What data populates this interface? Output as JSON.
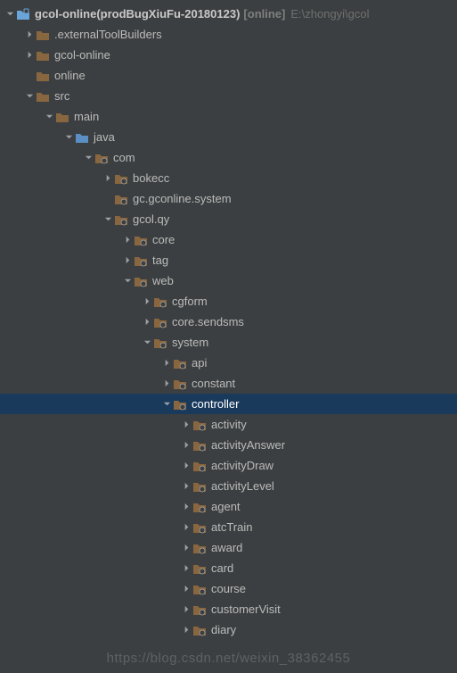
{
  "icons": {
    "module_fill": "#6aa4d8",
    "folder_fill": "#88663f",
    "pkg_fill": "#88663f",
    "src_fill": "#5b8ec4"
  },
  "watermark": "https://blog.csdn.net/weixin_38362455",
  "rows": [
    {
      "indent": 0,
      "arrow": "down",
      "icon": "module",
      "selected": false,
      "label": {
        "bold": "gcol-online(prodBugXiuFu-20180123)",
        "dec": "[online]",
        "path": "E:\\zhongyi\\gcol"
      }
    },
    {
      "indent": 1,
      "arrow": "right",
      "icon": "folder",
      "selected": false,
      "label": {
        "text": ".externalToolBuilders"
      }
    },
    {
      "indent": 1,
      "arrow": "right",
      "icon": "folder",
      "selected": false,
      "label": {
        "text": "gcol-online"
      }
    },
    {
      "indent": 1,
      "arrow": "blank",
      "icon": "folder",
      "selected": false,
      "label": {
        "text": "online"
      }
    },
    {
      "indent": 1,
      "arrow": "down",
      "icon": "folder",
      "selected": false,
      "label": {
        "text": "src"
      }
    },
    {
      "indent": 2,
      "arrow": "down",
      "icon": "folder",
      "selected": false,
      "label": {
        "text": "main"
      }
    },
    {
      "indent": 3,
      "arrow": "down",
      "icon": "src",
      "selected": false,
      "label": {
        "text": "java"
      }
    },
    {
      "indent": 4,
      "arrow": "down",
      "icon": "pkg",
      "selected": false,
      "label": {
        "text": "com"
      }
    },
    {
      "indent": 5,
      "arrow": "right",
      "icon": "pkg",
      "selected": false,
      "label": {
        "text": "bokecc"
      }
    },
    {
      "indent": 5,
      "arrow": "blank",
      "icon": "pkg",
      "selected": false,
      "label": {
        "text": "gc.gconline.system"
      }
    },
    {
      "indent": 5,
      "arrow": "down",
      "icon": "pkg",
      "selected": false,
      "label": {
        "text": "gcol.qy"
      }
    },
    {
      "indent": 6,
      "arrow": "right",
      "icon": "pkg",
      "selected": false,
      "label": {
        "text": "core"
      }
    },
    {
      "indent": 6,
      "arrow": "right",
      "icon": "pkg",
      "selected": false,
      "label": {
        "text": "tag"
      }
    },
    {
      "indent": 6,
      "arrow": "down",
      "icon": "pkg",
      "selected": false,
      "label": {
        "text": "web"
      }
    },
    {
      "indent": 7,
      "arrow": "right",
      "icon": "pkg",
      "selected": false,
      "label": {
        "text": "cgform"
      }
    },
    {
      "indent": 7,
      "arrow": "right",
      "icon": "pkg",
      "selected": false,
      "label": {
        "text": "core.sendsms"
      }
    },
    {
      "indent": 7,
      "arrow": "down",
      "icon": "pkg",
      "selected": false,
      "label": {
        "text": "system"
      }
    },
    {
      "indent": 8,
      "arrow": "right",
      "icon": "pkg",
      "selected": false,
      "label": {
        "text": "api"
      }
    },
    {
      "indent": 8,
      "arrow": "right",
      "icon": "pkg",
      "selected": false,
      "label": {
        "text": "constant"
      }
    },
    {
      "indent": 8,
      "arrow": "down",
      "icon": "pkg",
      "selected": true,
      "label": {
        "text": "controller"
      }
    },
    {
      "indent": 9,
      "arrow": "right",
      "icon": "pkg",
      "selected": false,
      "label": {
        "text": "activity"
      }
    },
    {
      "indent": 9,
      "arrow": "right",
      "icon": "pkg",
      "selected": false,
      "label": {
        "text": "activityAnswer"
      }
    },
    {
      "indent": 9,
      "arrow": "right",
      "icon": "pkg",
      "selected": false,
      "label": {
        "text": "activityDraw"
      }
    },
    {
      "indent": 9,
      "arrow": "right",
      "icon": "pkg",
      "selected": false,
      "label": {
        "text": "activityLevel"
      }
    },
    {
      "indent": 9,
      "arrow": "right",
      "icon": "pkg",
      "selected": false,
      "label": {
        "text": "agent"
      }
    },
    {
      "indent": 9,
      "arrow": "right",
      "icon": "pkg",
      "selected": false,
      "label": {
        "text": "atcTrain"
      }
    },
    {
      "indent": 9,
      "arrow": "right",
      "icon": "pkg",
      "selected": false,
      "label": {
        "text": "award"
      }
    },
    {
      "indent": 9,
      "arrow": "right",
      "icon": "pkg",
      "selected": false,
      "label": {
        "text": "card"
      }
    },
    {
      "indent": 9,
      "arrow": "right",
      "icon": "pkg",
      "selected": false,
      "label": {
        "text": "course"
      }
    },
    {
      "indent": 9,
      "arrow": "right",
      "icon": "pkg",
      "selected": false,
      "label": {
        "text": "customerVisit"
      }
    },
    {
      "indent": 9,
      "arrow": "right",
      "icon": "pkg",
      "selected": false,
      "label": {
        "text": "diary"
      }
    }
  ]
}
